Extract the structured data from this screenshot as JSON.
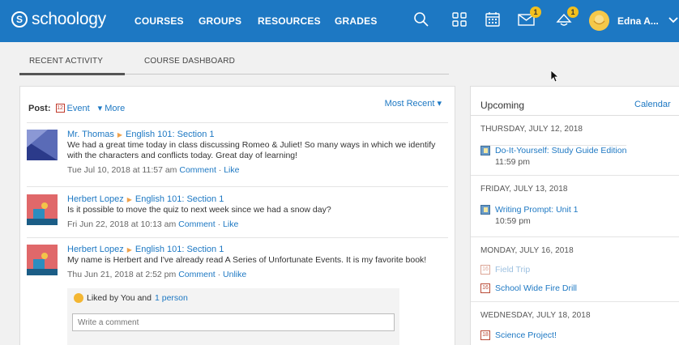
{
  "brand": {
    "logo_letter": "S",
    "name": "schoology",
    "accent": "#1d78c3"
  },
  "nav": {
    "items": [
      "COURSES",
      "GROUPS",
      "RESOURCES",
      "GRADES"
    ],
    "icons": [
      "search-icon",
      "apps-grid-icon",
      "calendar-icon",
      "messages-icon",
      "notifications-icon"
    ],
    "messages_badge": "1",
    "notifications_badge": "1",
    "user_name": "Edna A..."
  },
  "tabs": [
    "RECENT ACTIVITY",
    "COURSE DASHBOARD"
  ],
  "feed": {
    "post_label": "Post:",
    "event_label": "Event",
    "event_icon_day": "12",
    "more_label": "More",
    "sort_label": "Most Recent",
    "items": [
      {
        "author": "Mr. Thomas",
        "course": "English 101: Section 1",
        "text": "We had a great time today in class discussing Romeo & Juliet! So many ways in which we identify with the characters and conflicts today. Great day of learning!",
        "time": "Tue Jul 10, 2018 at 11:57 am",
        "comment": "Comment",
        "sep": "·",
        "like": "Like"
      },
      {
        "author": "Herbert Lopez",
        "course": "English 101: Section 1",
        "text": "Is it possible to move the quiz to next week since we had a snow day?",
        "time": "Fri Jun 22, 2018 at 10:13 am",
        "comment": "Comment",
        "sep": "·",
        "like": "Like"
      },
      {
        "author": "Herbert Lopez",
        "course": "English 101: Section 1",
        "text": "My name is Herbert and I've already read A Series of Unfortunate Events. It is my favorite book!",
        "time": "Thu Jun 21, 2018 at 2:52 pm",
        "comment": "Comment",
        "sep": "·",
        "like": "Unlike"
      }
    ],
    "likes_text": "Liked by You and",
    "likes_link": "1 person",
    "comment_placeholder": "Write a comment"
  },
  "upcoming": {
    "title": "Upcoming",
    "calendar_link": "Calendar",
    "days": [
      {
        "label": "THURSDAY, JULY 12, 2018",
        "events": [
          {
            "title": "Do-It-Yourself: Study Guide Edition",
            "time": "11:59 pm",
            "icon": "assignment-icon"
          }
        ]
      },
      {
        "label": "FRIDAY, JULY 13, 2018",
        "events": [
          {
            "title": "Writing Prompt: Unit 1",
            "time": "10:59 pm",
            "icon": "assignment-icon"
          }
        ]
      },
      {
        "label": "MONDAY, JULY 16, 2018",
        "events": [
          {
            "title": "Field Trip",
            "time": "",
            "icon": "calendar-event-icon",
            "day": "16",
            "faded": true
          },
          {
            "title": "School Wide Fire Drill",
            "time": "",
            "icon": "calendar-event-icon",
            "day": "16"
          }
        ]
      },
      {
        "label": "WEDNESDAY, JULY 18, 2018",
        "events": [
          {
            "title": "Science Project!",
            "time": "",
            "icon": "calendar-event-icon",
            "day": "18"
          }
        ]
      }
    ]
  }
}
